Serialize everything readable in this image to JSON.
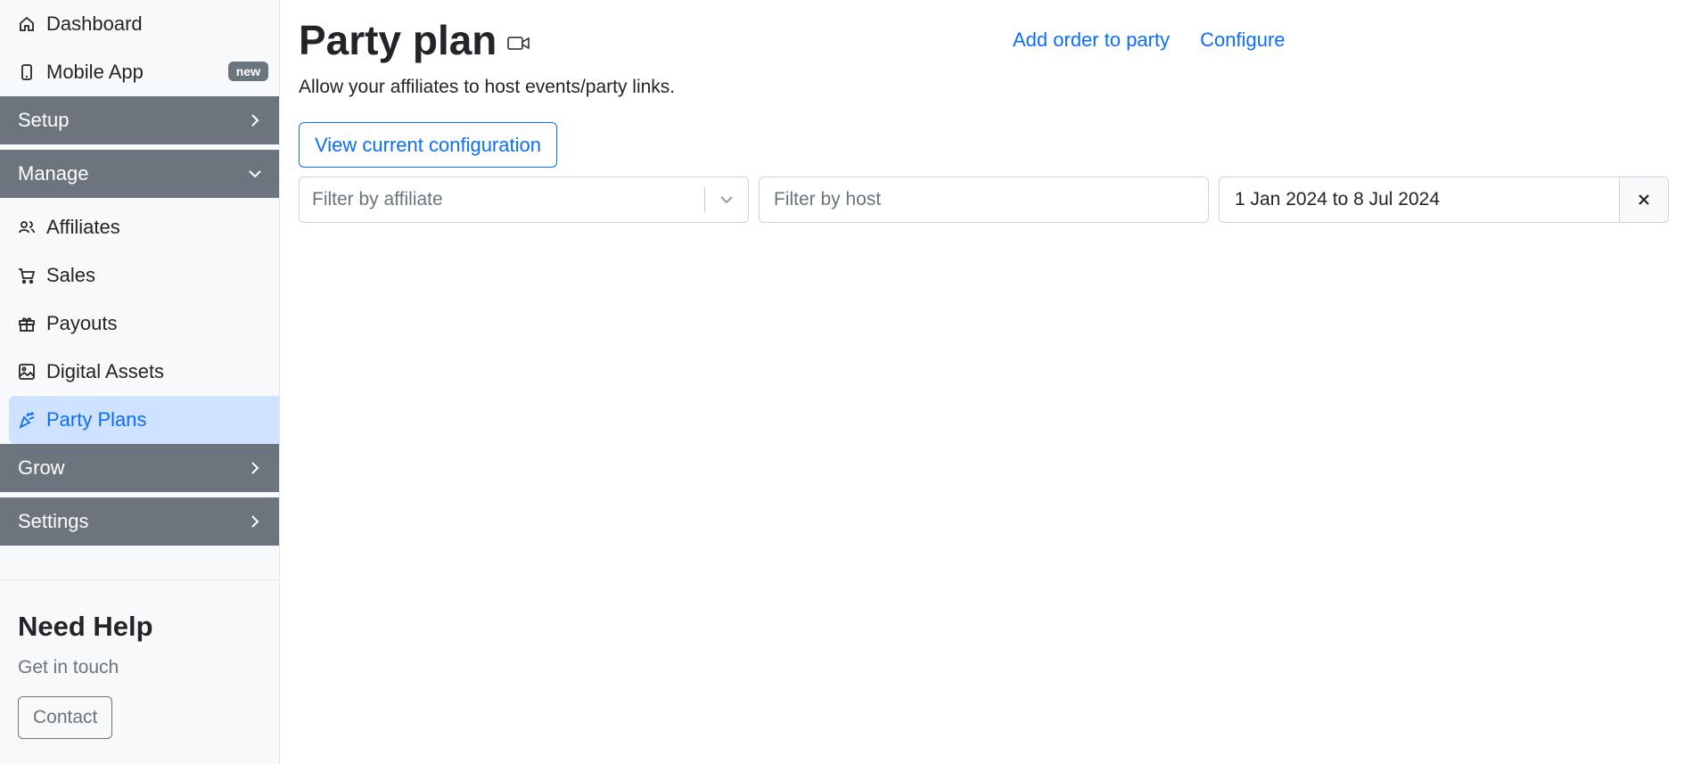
{
  "sidebar": {
    "top_items": [
      {
        "label": "Dashboard",
        "icon": "home-icon"
      },
      {
        "label": "Mobile App",
        "icon": "mobile-icon",
        "badge": "new"
      }
    ],
    "sections": {
      "setup": "Setup",
      "manage": "Manage",
      "grow": "Grow",
      "settings": "Settings"
    },
    "manage_items": [
      {
        "label": "Affiliates",
        "icon": "users-icon"
      },
      {
        "label": "Sales",
        "icon": "cart-icon"
      },
      {
        "label": "Payouts",
        "icon": "gift-icon"
      },
      {
        "label": "Digital Assets",
        "icon": "image-icon"
      },
      {
        "label": "Party Plans",
        "icon": "party-popper-icon",
        "active": true
      }
    ],
    "help": {
      "title": "Need Help",
      "text": "Get in touch",
      "button": "Contact"
    }
  },
  "main": {
    "title": "Party plan",
    "subtitle": "Allow your affiliates to host events/party links.",
    "links": {
      "add_order": "Add order to party",
      "configure": "Configure"
    },
    "view_config_button": "View current configuration",
    "filters": {
      "affiliate_placeholder": "Filter by affiliate",
      "host_placeholder": "Filter by host",
      "date_range": "1 Jan 2024 to 8 Jul 2024"
    }
  },
  "colors": {
    "accent": "#0d6efd",
    "section_bg": "#6c757d",
    "active_bg": "#cfe2ff"
  }
}
